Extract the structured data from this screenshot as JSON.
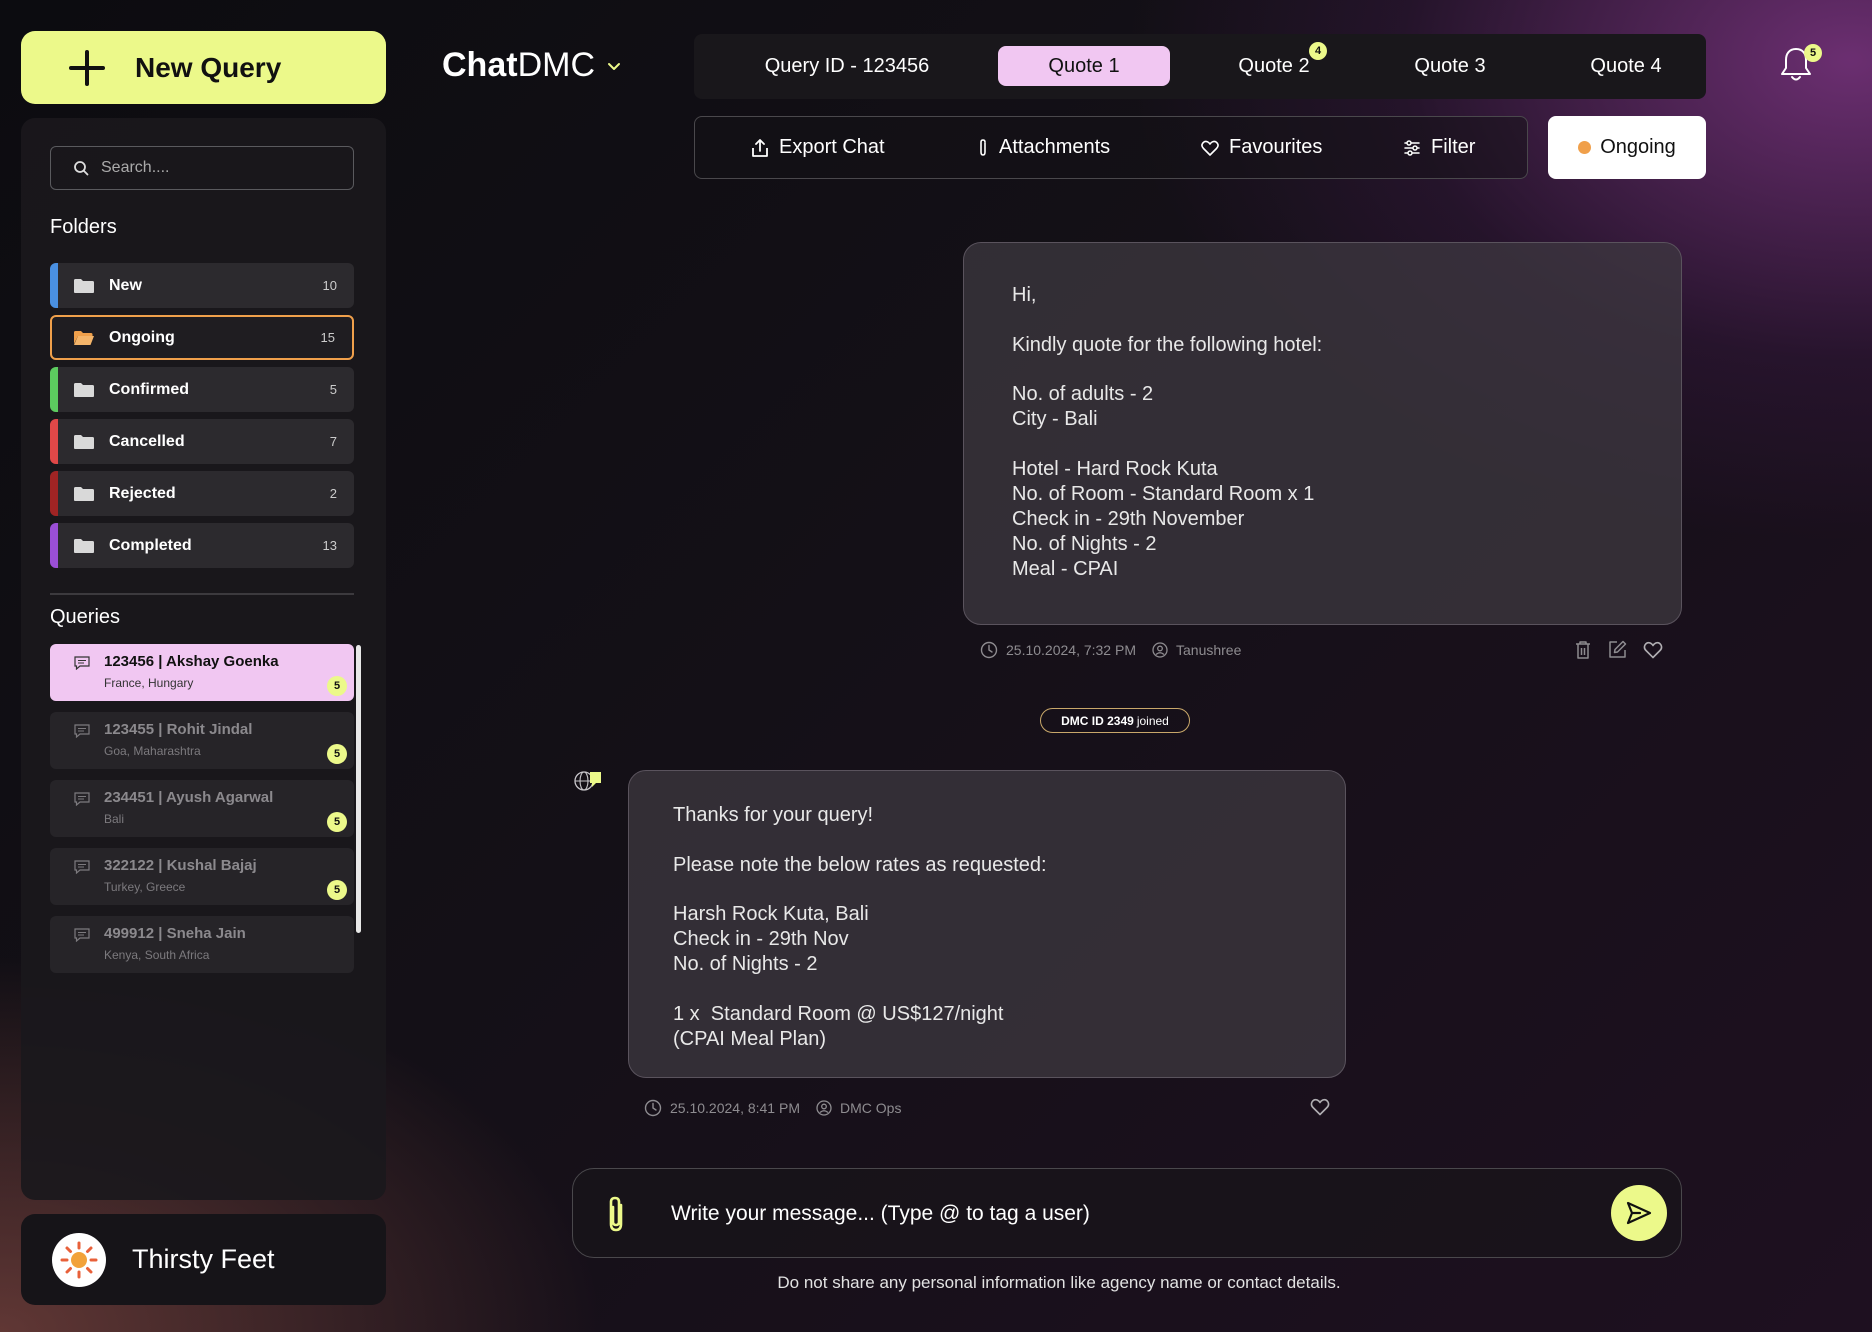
{
  "new_query_label": "New Query",
  "search": {
    "placeholder": "Search...."
  },
  "folders_title": "Folders",
  "folders": [
    {
      "name": "New",
      "count": "10",
      "color": "#4a90e2"
    },
    {
      "name": "Ongoing",
      "count": "15",
      "color": "#f0a04b"
    },
    {
      "name": "Confirmed",
      "count": "5",
      "color": "#5ccb5f"
    },
    {
      "name": "Cancelled",
      "count": "7",
      "color": "#e04848"
    },
    {
      "name": "Rejected",
      "count": "2",
      "color": "#a02424"
    },
    {
      "name": "Completed",
      "count": "13",
      "color": "#9b4fd6"
    }
  ],
  "queries_title": "Queries",
  "queries": [
    {
      "title": "123456 | Akshay Goenka",
      "subtitle": "France, Hungary",
      "badge": "5"
    },
    {
      "title": "123455 | Rohit Jindal",
      "subtitle": "Goa, Maharashtra",
      "badge": "5"
    },
    {
      "title": "234451 | Ayush Agarwal",
      "subtitle": "Bali",
      "badge": "5"
    },
    {
      "title": "322122 | Kushal Bajaj",
      "subtitle": "Turkey, Greece",
      "badge": "5"
    },
    {
      "title": "499912 | Sneha Jain",
      "subtitle": "Kenya, South Africa",
      "badge": ""
    }
  ],
  "account_name": "Thirsty Feet",
  "brand": {
    "bold": "Chat",
    "regular": "DMC"
  },
  "tabs": {
    "query_id": "Query ID - 123456",
    "quote1": "Quote 1",
    "quote2": "Quote 2",
    "quote2_badge": "4",
    "quote3": "Quote 3",
    "quote4": "Quote 4"
  },
  "notifications_badge": "5",
  "toolbar": {
    "export": "Export Chat",
    "attachments": "Attachments",
    "favourites": "Favourites",
    "filter": "Filter"
  },
  "status": "Ongoing",
  "messages": [
    {
      "lines": [
        "Hi,",
        "",
        "Kindly quote for the following hotel:",
        "",
        "No. of adults - 2",
        "City - Bali",
        "",
        "Hotel - Hard Rock Kuta",
        "No. of Room - Standard Room x 1",
        "Check in - 29th November",
        "No. of Nights - 2",
        "Meal - CPAI"
      ],
      "time": "25.10.2024, 7:32 PM",
      "author": "Tanushree"
    },
    {
      "lines": [
        "Thanks for your query!",
        "",
        "Please note the below rates as requested:",
        "",
        "Harsh Rock Kuta, Bali",
        "Check in - 29th Nov",
        "No. of Nights - 2",
        "",
        "1 x  Standard Room @ US$127/night",
        "(CPAI Meal Plan)"
      ],
      "time": "25.10.2024, 8:41 PM",
      "author": "DMC Ops"
    }
  ],
  "joined": {
    "id": "DMC ID 2349",
    "text": "joined"
  },
  "composer": {
    "placeholder": "Write your message... (Type @ to tag a user)"
  },
  "disclaimer": "Do not share any personal information like agency name or contact details.",
  "colors": {
    "accent_lime": "#ecf98a",
    "accent_pink": "#f1c7f2",
    "status_orange": "#f0a04b"
  }
}
